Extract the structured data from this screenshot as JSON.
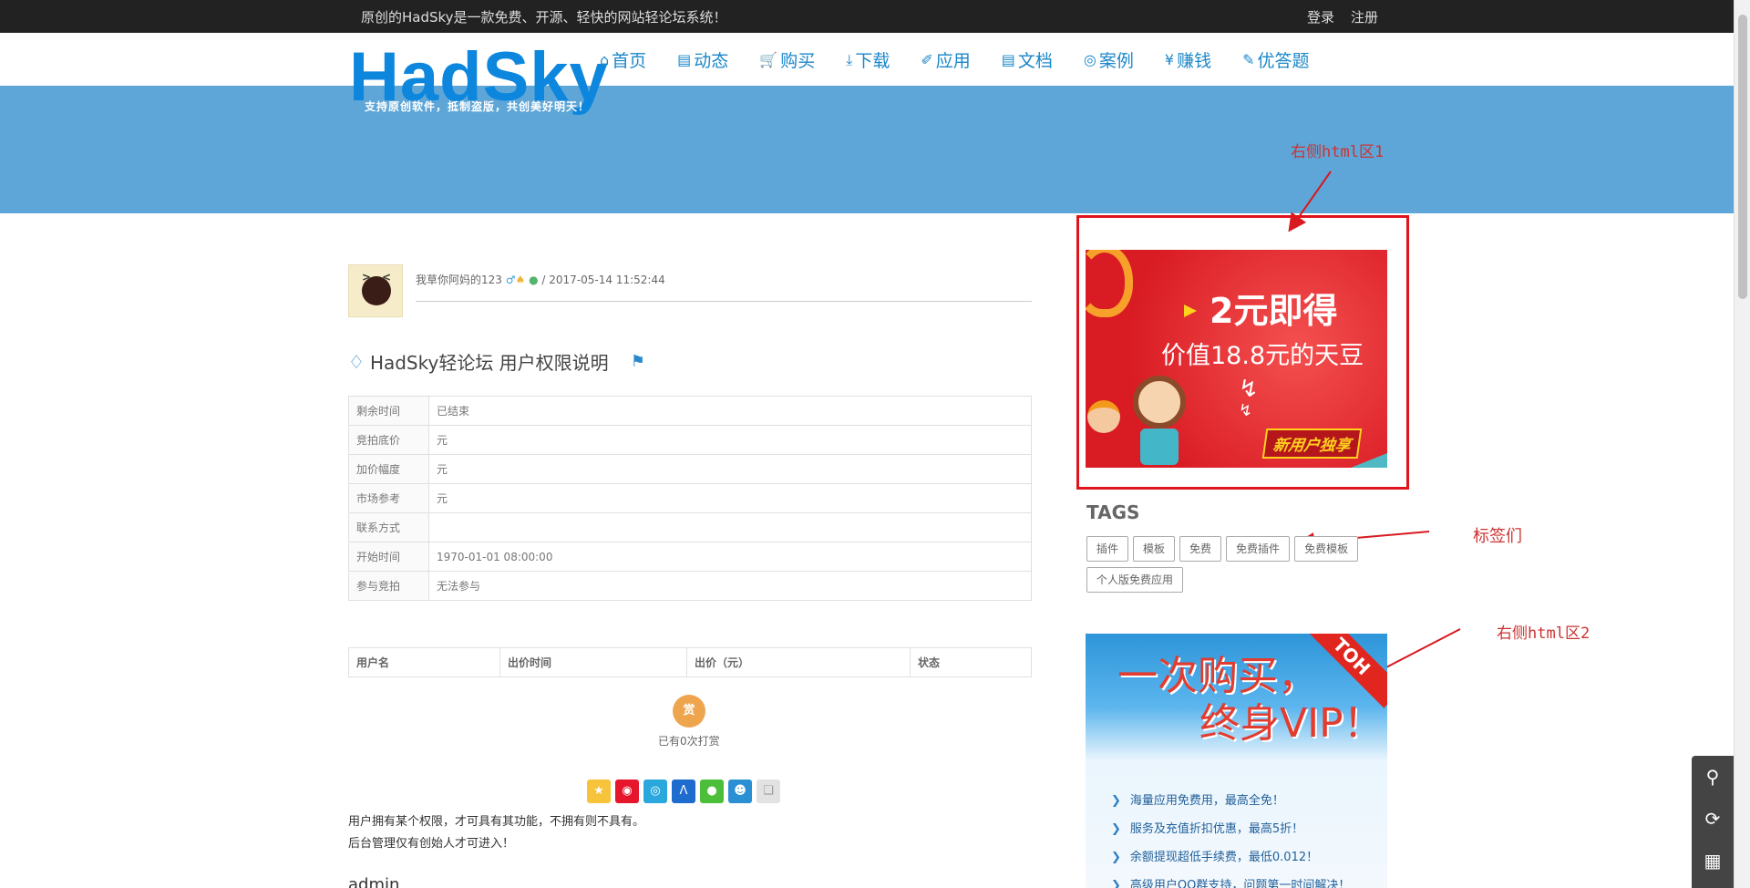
{
  "topbar": {
    "notice": "原创的HadSky是一款免费、开源、轻快的网站轻论坛系统！",
    "login": "登录",
    "register": "注册"
  },
  "header": {
    "logo": "HadSky",
    "slogan": "支持原创软件，抵制盗版，共创美好明天！",
    "nav": [
      {
        "icon": "home-icon",
        "label": "首页"
      },
      {
        "icon": "activity-icon",
        "label": "动态"
      },
      {
        "icon": "cart-icon",
        "label": "购买"
      },
      {
        "icon": "download-icon",
        "label": "下载"
      },
      {
        "icon": "plugin-icon",
        "label": "应用"
      },
      {
        "icon": "book-icon",
        "label": "文档"
      },
      {
        "icon": "eye-icon",
        "label": "案例"
      },
      {
        "icon": "yen-icon",
        "label": "赚钱"
      },
      {
        "icon": "edit-icon",
        "label": "优答题"
      }
    ]
  },
  "annotations": {
    "right_html_1": "右侧html区1",
    "tags_note": "标签们",
    "right_html_2": "右侧html区2"
  },
  "ad1": {
    "headline": "2元即得",
    "subline": "价值18.8元的天豆",
    "badge": "新用户独享"
  },
  "tags": {
    "title": "TAGS",
    "items": [
      "插件",
      "模板",
      "免费",
      "免费插件",
      "免费模板",
      "个人版免费应用"
    ]
  },
  "ad2": {
    "line1": "一次购买，",
    "line2": "终身VIP！",
    "corner": "TOH",
    "features": [
      "海量应用免费用，最高全免！",
      "服务及充值折扣优惠，最高5折！",
      "余额提现超低手续费，最低0.012！",
      "高级用户QQ群支持，问题第一时间解决！"
    ]
  },
  "post": {
    "author": "我草你阿妈的123",
    "separator": "/",
    "datetime": "2017-05-14 11:52:44",
    "title": "HadSky轻论坛 用户权限说明",
    "info": [
      {
        "k": "剩余时间",
        "v": "已结束"
      },
      {
        "k": "竞拍底价",
        "v": "元"
      },
      {
        "k": "加价幅度",
        "v": "元"
      },
      {
        "k": "市场参考",
        "v": "元"
      },
      {
        "k": "联系方式",
        "v": ""
      },
      {
        "k": "开始时间",
        "v": "1970-01-01 08:00:00"
      },
      {
        "k": "参与竞拍",
        "v": "无法参与"
      }
    ],
    "bid_headers": [
      "用户名",
      "出价时间",
      "出价（元）",
      "状态"
    ],
    "reward_btn": "赏",
    "reward_text": "已有0次打赏",
    "body_line1": "用户拥有某个权限，才可具有其功能，不拥有则不具有。",
    "body_line2": "后台管理仅有创始人才可进入！",
    "body_line3": "admin"
  },
  "share_icons": [
    "qzone-icon",
    "weibo-icon",
    "tencent-weibo-icon",
    "renren-icon",
    "wechat-icon",
    "qq-icon",
    "copy-icon"
  ],
  "colors": {
    "accent": "#1a87c9",
    "banner": "#5ea6d7",
    "logo": "#0d86dd",
    "annotation": "#cc3333"
  }
}
